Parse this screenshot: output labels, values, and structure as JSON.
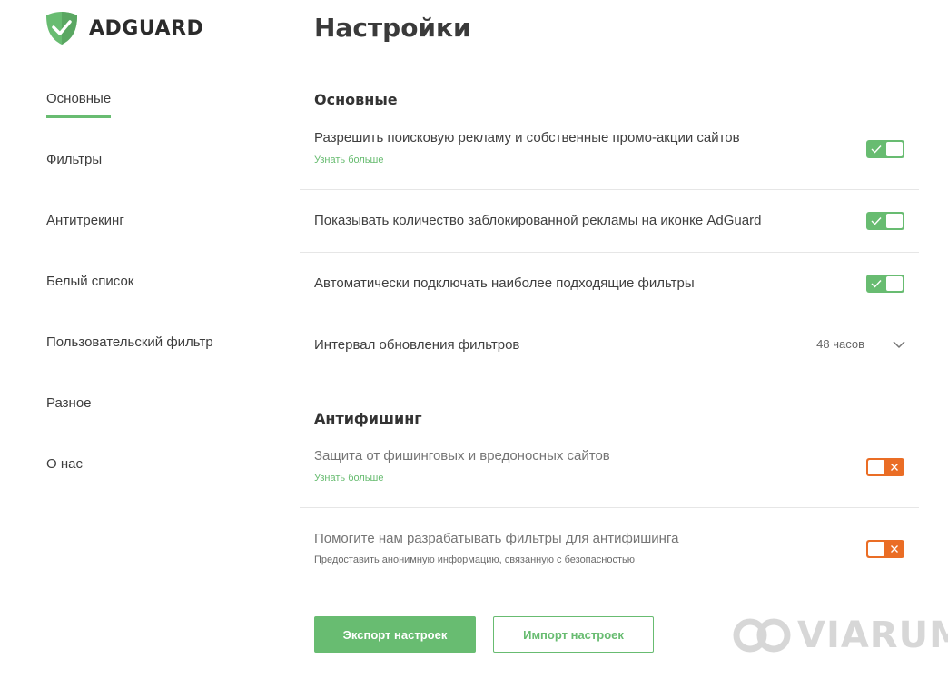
{
  "brand": {
    "name": "ADGUARD",
    "accent": "#68bc71",
    "warning": "#ea6d25"
  },
  "page": {
    "title": "Настройки"
  },
  "sidebar": {
    "items": [
      {
        "label": "Основные",
        "active": true
      },
      {
        "label": "Фильтры"
      },
      {
        "label": "Антитрекинг"
      },
      {
        "label": "Белый список"
      },
      {
        "label": "Пользовательский фильтр"
      },
      {
        "label": "Разное"
      },
      {
        "label": "О нас"
      }
    ]
  },
  "sections": {
    "general": {
      "title": "Основные",
      "search_ads": {
        "label": "Разрешить поисковую рекламу и собственные промо-акции сайтов",
        "link": "Узнать больше",
        "enabled": true
      },
      "blocked_count": {
        "label": "Показывать количество заблокированной рекламы на иконке AdGuard",
        "enabled": true
      },
      "auto_filters": {
        "label": "Автоматически подключать наиболее подходящие фильтры",
        "enabled": true
      },
      "update_interval": {
        "label": "Интервал обновления фильтров",
        "value": "48 часов"
      }
    },
    "antiphishing": {
      "title": "Антифишинг",
      "protection": {
        "label": "Защита от фишинговых и вредоносных сайтов",
        "link": "Узнать больше",
        "enabled": false
      },
      "help": {
        "label": "Помогите нам разрабатывать фильтры для антифишинга",
        "description": "Предоставить анонимную информацию, связанную с безопасностью",
        "enabled": false
      }
    }
  },
  "actions": {
    "export_label": "Экспорт настроек",
    "import_label": "Импорт настроек"
  },
  "watermark": {
    "text": "VIARUM"
  }
}
